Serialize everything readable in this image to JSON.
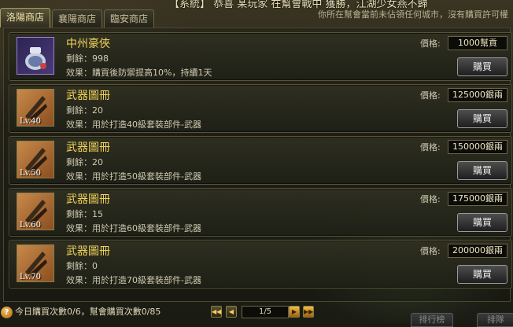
{
  "ticker": "【系統】 恭喜 某玩家 在幫會戰中 獲勝，江湖少女燕不歸",
  "tabs": [
    {
      "label": "洛陽商店",
      "active": true
    },
    {
      "label": "襄陽商店",
      "active": false
    },
    {
      "label": "臨安商店",
      "active": false
    }
  ],
  "notice": "你所在幫會當前未佔領任何城市，沒有購買許可權",
  "price_label": "價格:",
  "buy_label": "購買",
  "items": [
    {
      "name": "中州豪俠",
      "remain": "剩餘：998",
      "effect": "效果：購買後防禦提高10%，持續1天",
      "price": "1000幫貢",
      "icon": "potion-jar-icon",
      "level": ""
    },
    {
      "name": "武器圖冊",
      "remain": "剩餘：20",
      "effect": "效果：用於打造40級套裝部件-武器",
      "price": "125000銀兩",
      "icon": "weapon-scroll-icon",
      "level": "Lv.40"
    },
    {
      "name": "武器圖冊",
      "remain": "剩餘：20",
      "effect": "效果：用於打造50級套裝部件-武器",
      "price": "150000銀兩",
      "icon": "weapon-scroll-icon",
      "level": "Lv.50"
    },
    {
      "name": "武器圖冊",
      "remain": "剩餘：15",
      "effect": "效果：用於打造60級套裝部件-武器",
      "price": "175000銀兩",
      "icon": "weapon-scroll-icon",
      "level": "Lv.60"
    },
    {
      "name": "武器圖冊",
      "remain": "剩餘：0",
      "effect": "效果：用於打造70級套裝部件-武器",
      "price": "200000銀兩",
      "icon": "weapon-scroll-icon",
      "level": "Lv.70"
    }
  ],
  "footer": {
    "help_icon": "?",
    "buy_count": "今日購買次數0/6，幫會購買次數0/85",
    "page": "1/5",
    "btn_left": "排行榜",
    "btn_right": "排隊"
  }
}
